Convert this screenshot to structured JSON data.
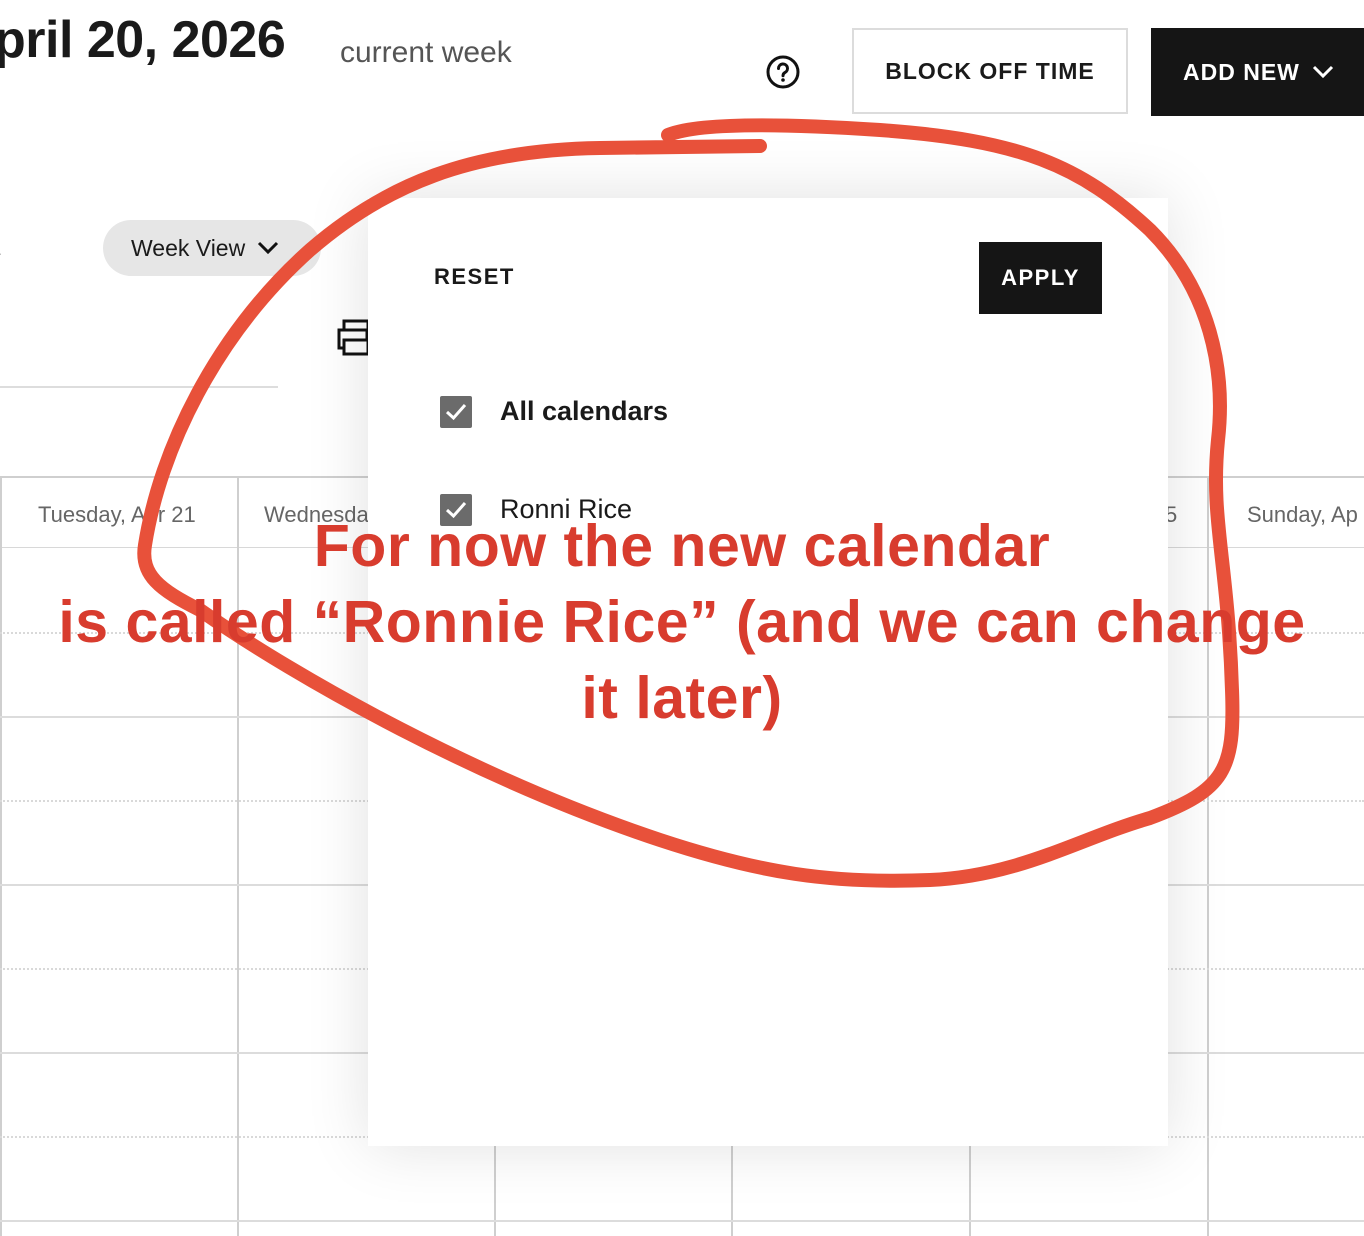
{
  "header": {
    "date_title": "pril 20, 2026",
    "week_label": "current week",
    "help_icon": "help-circle-icon",
    "block_off_label": "BLOCK OFF TIME",
    "add_new_label": "ADD NEW",
    "add_new_icon": "chevron-down-icon"
  },
  "toolbar": {
    "view_label": "Week View",
    "view_icon": "chevron-down-icon",
    "print_icon": "print-icon",
    "edge_arrow": "›"
  },
  "calendar": {
    "days": [
      {
        "label": "Tuesday, Apr 21"
      },
      {
        "label": "Wednesday"
      },
      {
        "label": "5"
      },
      {
        "label": "Sunday, Ap"
      }
    ]
  },
  "filter_popover": {
    "reset_label": "RESET",
    "apply_label": "APPLY",
    "options": [
      {
        "label": "All calendars",
        "checked": true
      },
      {
        "label": "Ronni Rice",
        "checked": true
      }
    ]
  },
  "annotation": {
    "color": "#e8513a",
    "lines": [
      "For now the new calendar",
      "is called “Ronnie Rice” (and we can change",
      "it later)"
    ]
  }
}
